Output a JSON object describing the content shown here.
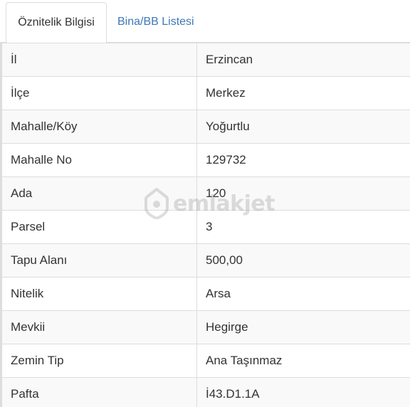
{
  "tabs": [
    {
      "label": "Öznitelik Bilgisi",
      "active": true
    },
    {
      "label": "Bina/BB Listesi",
      "active": false
    }
  ],
  "rows": [
    {
      "label": "İl",
      "value": "Erzincan"
    },
    {
      "label": "İlçe",
      "value": "Merkez"
    },
    {
      "label": "Mahalle/Köy",
      "value": "Yoğurtlu"
    },
    {
      "label": "Mahalle No",
      "value": "129732"
    },
    {
      "label": "Ada",
      "value": "120"
    },
    {
      "label": "Parsel",
      "value": "3"
    },
    {
      "label": "Tapu Alanı",
      "value": "500,00"
    },
    {
      "label": "Nitelik",
      "value": "Arsa"
    },
    {
      "label": "Mevkii",
      "value": "Hegirge"
    },
    {
      "label": "Zemin Tip",
      "value": "Ana Taşınmaz"
    },
    {
      "label": "Pafta",
      "value": "İ43.D1.1A"
    }
  ],
  "watermark": {
    "text": "emlakjet",
    "icon": "house-pin-icon"
  },
  "colors": {
    "tab_link": "#3f78b5",
    "text": "#333333",
    "border": "#dddddd",
    "row_stripe": "#f9f9f9"
  }
}
